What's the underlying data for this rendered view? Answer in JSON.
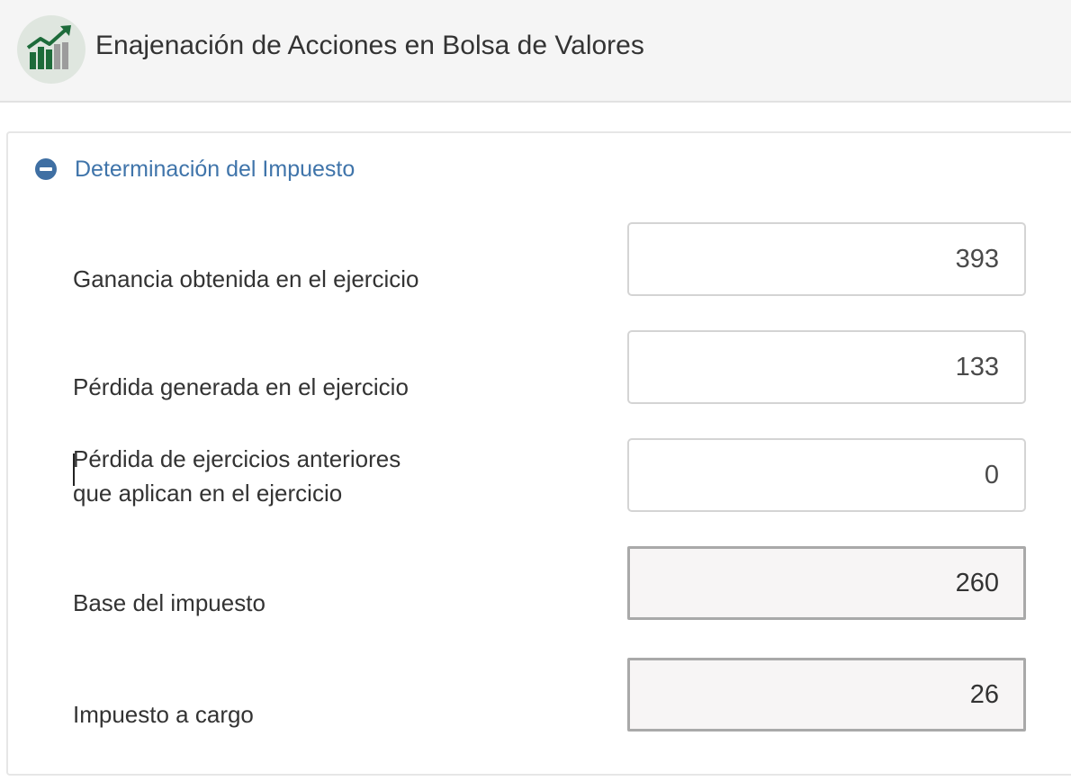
{
  "header": {
    "title": "Enajenación de Acciones en Bolsa de Valores",
    "icon": "chart-growth-icon",
    "colors": {
      "icon_bg": "#dfe6df",
      "icon_green": "#1d6b3a",
      "icon_gray": "#9c9c9c"
    }
  },
  "section": {
    "title": "Determinación del Impuesto",
    "toggle_icon": "minus-circle-icon",
    "accent_color": "#3f74aa"
  },
  "fields": [
    {
      "label": "Ganancia obtenida en el ejercicio",
      "value": "393",
      "readonly": false
    },
    {
      "label": "Pérdida generada en el ejercicio",
      "value": "133",
      "readonly": false
    },
    {
      "label_line1": "Pérdida de ejercicios anteriores",
      "label_line2": "que aplican en el ejercicio",
      "value": "0",
      "readonly": false
    },
    {
      "label": "Base del impuesto",
      "value": "260",
      "readonly": true
    },
    {
      "label": "Impuesto a cargo",
      "value": "26",
      "readonly": true
    }
  ]
}
